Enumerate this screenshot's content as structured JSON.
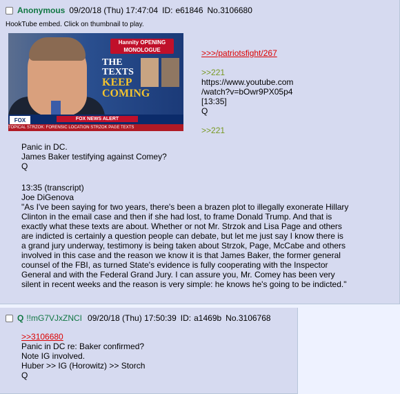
{
  "post1": {
    "name": "Anonymous",
    "date": "09/20/18 (Thu) 17:47:04",
    "id_label": "ID:",
    "id": "e61846",
    "no_label": "No.",
    "number": "3106680",
    "embed_note": "HookTube embed. Click on thumbnail to play.",
    "thumbnail": {
      "opening_label": "Hannity OPENING MONOLOGUE",
      "headline_1": "THE",
      "headline_2": "TEXTS",
      "headline_3": "KEEP",
      "headline_4": "COMING",
      "alert": "FOX NEWS ALERT",
      "logo": "FOX NEWS",
      "ticker": "TOPICAL STRZOK: FORENSIC  LOCATION  STRZOK PAGE TEXTS"
    },
    "side_lines": [
      ">>>/patriotsfight/267",
      "",
      ">>221",
      "https://www.youtube.com",
      "/watch?v=bOwr9PX05p4",
      "[13:35]",
      "Q",
      "",
      ">>221"
    ],
    "body_1": [
      "Panic in DC.",
      "James Baker testifying against Comey?",
      "Q"
    ],
    "body_2": [
      "13:35 (transcript)",
      "Joe DiGenova",
      "\"As I've been saying for two years, there's been a brazen plot to illegally exonerate Hillary",
      "Clinton in the email case and then if she had lost, to frame Donald Trump. And that is",
      "exactly what these texts are about. Whether or not Mr. Strzok and Lisa Page and others",
      "are indicted is certainly a question people can debate, but let me just say I know there is",
      "a grand jury underway, testimony is being taken about Strzok, Page, McCabe and others",
      "involved in this case and the reason we know it is that James Baker, the former general",
      "counsel of the FBI, as turned State's evidence is fully cooperating with the Inspector",
      "General and with the Federal Grand Jury. I can assure you, Mr. Comey has been very",
      "silent in recent weeks and the reason is very simple: he knows he's going to be indicted.\""
    ]
  },
  "post2": {
    "name": "Q",
    "tripcode": "!!mG7VJxZNCI",
    "date": "09/20/18 (Thu) 17:50:39",
    "id_label": "ID:",
    "id": "a1469b",
    "no_label": "No.",
    "number": "3106768",
    "lines": [
      ">>3106680",
      "Panic in DC re: Baker confirmed?",
      "Note IG involved.",
      "Huber >> IG (Horowitz) >> Storch",
      "Q"
    ]
  },
  "colors": {
    "post_bg": "#d6daf0",
    "page_bg": "#eef2ff",
    "name": "#117743",
    "link": "#dd0000",
    "greentext": "#789922"
  }
}
